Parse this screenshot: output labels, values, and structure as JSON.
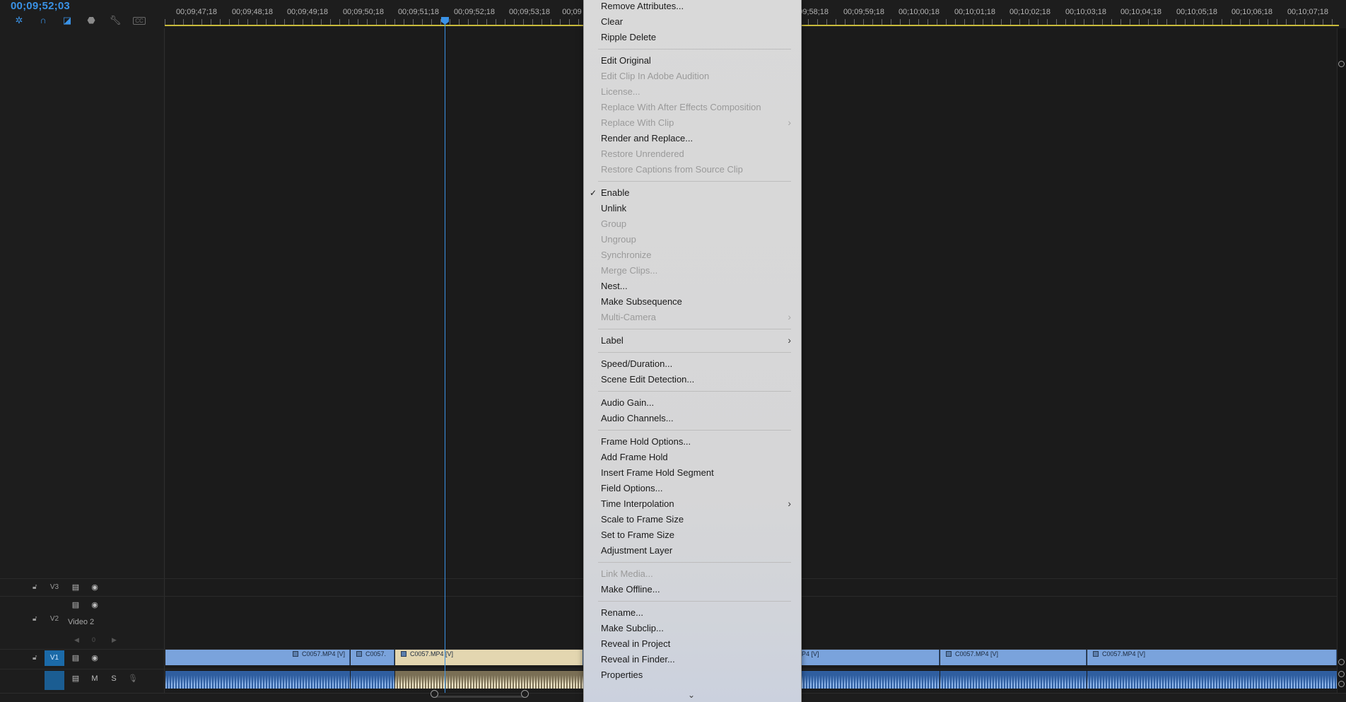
{
  "timeline": {
    "timecode": "00;09;52;03",
    "tools": [
      {
        "icon": "ripple-tool-icon"
      },
      {
        "icon": "snap-magnet-icon"
      },
      {
        "icon": "linked-selection-icon"
      },
      {
        "icon": "add-marker-icon"
      },
      {
        "icon": "wrench-settings-icon"
      },
      {
        "icon": "captions-icon",
        "label": "CC"
      }
    ],
    "ruler_labels": [
      "00;09;47;18",
      "00;09;48;18",
      "00;09;49;18",
      "00;09;50;18",
      "00;09;51;18",
      "00;09;52;18",
      "00;09;53;18",
      "00;09",
      "00;09;58;18",
      "00;09;59;18",
      "00;10;00;18",
      "00;10;01;18",
      "00;10;02;18",
      "00;10;03;18",
      "00;10;04;18",
      "00;10;05;18",
      "00;10;06;18",
      "00;10;07;18"
    ],
    "tracks": {
      "v3": "V3",
      "v2": "V2",
      "v2_name": "Video 2",
      "v2_counter": "0",
      "v1": "V1",
      "a_m": "M",
      "a_s": "S"
    },
    "clips": [
      {
        "label": "C0057.MP4 [V]"
      },
      {
        "label": "C0057."
      },
      {
        "label": "C0057.MP4 [V]",
        "selected": true
      },
      {
        "label": "P4 [V]"
      },
      {
        "label": "C0057.MP4 [V]"
      },
      {
        "label": "C0057.MP4 [V]"
      }
    ],
    "colors": {
      "accent": "#3a92e6",
      "clip": "#7aa3dc",
      "selected_clip": "#e3d6b0",
      "ruler_line": "#c9bb3c"
    }
  },
  "menu": {
    "items": [
      {
        "label": "Remove Attributes...",
        "enabled": true
      },
      {
        "label": "Clear",
        "enabled": true
      },
      {
        "label": "Ripple Delete",
        "enabled": true
      },
      {
        "label": "Edit Original",
        "enabled": true
      },
      {
        "label": "Edit Clip In Adobe Audition",
        "enabled": false
      },
      {
        "label": "License...",
        "enabled": false
      },
      {
        "label": "Replace With After Effects Composition",
        "enabled": false
      },
      {
        "label": "Replace With Clip",
        "enabled": false,
        "submenu": true
      },
      {
        "label": "Render and Replace...",
        "enabled": true
      },
      {
        "label": "Restore Unrendered",
        "enabled": false
      },
      {
        "label": "Restore Captions from Source Clip",
        "enabled": false
      },
      {
        "label": "Enable",
        "enabled": true,
        "checked": true
      },
      {
        "label": "Unlink",
        "enabled": true
      },
      {
        "label": "Group",
        "enabled": false
      },
      {
        "label": "Ungroup",
        "enabled": false
      },
      {
        "label": "Synchronize",
        "enabled": false
      },
      {
        "label": "Merge Clips...",
        "enabled": false
      },
      {
        "label": "Nest...",
        "enabled": true
      },
      {
        "label": "Make Subsequence",
        "enabled": true
      },
      {
        "label": "Multi-Camera",
        "enabled": false,
        "submenu": true
      },
      {
        "label": "Label",
        "enabled": true,
        "submenu": true
      },
      {
        "label": "Speed/Duration...",
        "enabled": true
      },
      {
        "label": "Scene Edit Detection...",
        "enabled": true
      },
      {
        "label": "Audio Gain...",
        "enabled": true
      },
      {
        "label": "Audio Channels...",
        "enabled": true
      },
      {
        "label": "Frame Hold Options...",
        "enabled": true
      },
      {
        "label": "Add Frame Hold",
        "enabled": true
      },
      {
        "label": "Insert Frame Hold Segment",
        "enabled": true
      },
      {
        "label": "Field Options...",
        "enabled": true
      },
      {
        "label": "Time Interpolation",
        "enabled": true,
        "submenu": true
      },
      {
        "label": "Scale to Frame Size",
        "enabled": true
      },
      {
        "label": "Set to Frame Size",
        "enabled": true
      },
      {
        "label": "Adjustment Layer",
        "enabled": true
      },
      {
        "label": "Link Media...",
        "enabled": false
      },
      {
        "label": "Make Offline...",
        "enabled": true
      },
      {
        "label": "Rename...",
        "enabled": true
      },
      {
        "label": "Make Subclip...",
        "enabled": true
      },
      {
        "label": "Reveal in Project",
        "enabled": true
      },
      {
        "label": "Reveal in Finder...",
        "enabled": true
      },
      {
        "label": "Properties",
        "enabled": true
      }
    ],
    "more_icon": "chevron-down-icon"
  }
}
